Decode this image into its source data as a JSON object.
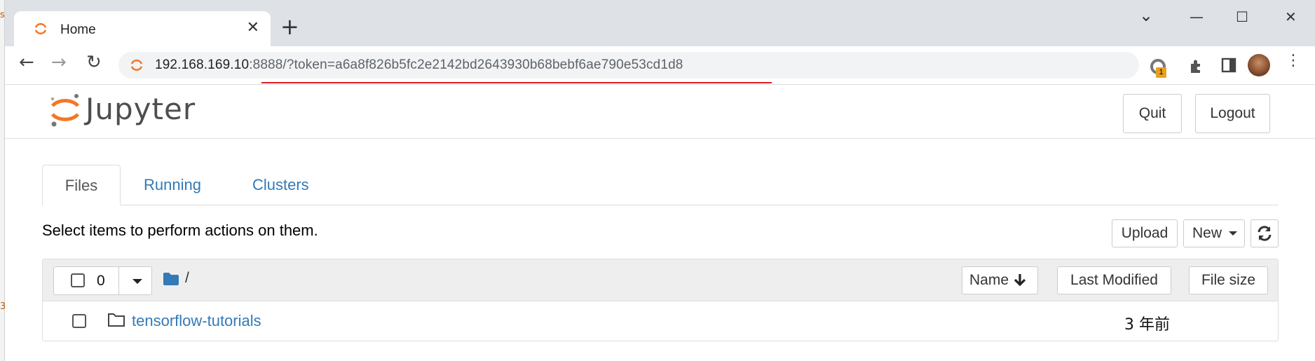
{
  "browser": {
    "tab": {
      "title": "Home",
      "close_glyph": "✕"
    },
    "new_tab_glyph": "+",
    "window_controls": {
      "dropdown": "⌄",
      "minimize": "—",
      "maximize": "☐",
      "close": "✕"
    },
    "nav": {
      "back": "←",
      "forward": "→",
      "reload": "↻"
    },
    "address": {
      "host": "192.168.169.10",
      "rest": ":8888/?token=a6a8f826b5fc2e2142bd2643930b68bebf6ae790e53cd1d8"
    },
    "extension_badge": "1",
    "menu_glyph": "⋮"
  },
  "jupyter": {
    "logo_text": "Jupyter",
    "buttons": {
      "quit": "Quit",
      "logout": "Logout"
    },
    "tabs": [
      {
        "label": "Files",
        "active": true
      },
      {
        "label": "Running",
        "active": false
      },
      {
        "label": "Clusters",
        "active": false
      }
    ],
    "instructions": "Select items to perform actions on them.",
    "toolbar": {
      "upload": "Upload",
      "new": "New",
      "refresh_icon": "refresh-icon"
    },
    "list_header": {
      "selected_count": "0",
      "breadcrumb": "/",
      "columns": {
        "name": "Name",
        "last_modified": "Last Modified",
        "file_size": "File size"
      }
    },
    "rows": [
      {
        "name": "tensorflow-tutorials",
        "modified": "3 年前",
        "type": "folder"
      }
    ]
  },
  "colors": {
    "accent": "#337ab7",
    "jupyter_orange": "#f37726",
    "tabbar": "#dee1e6"
  }
}
